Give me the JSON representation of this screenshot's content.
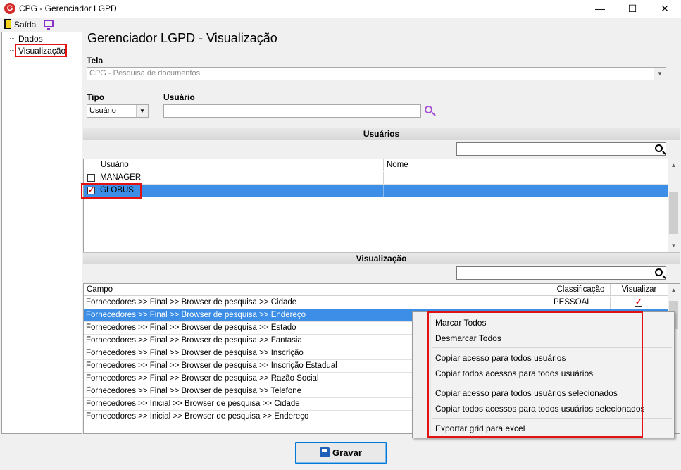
{
  "window": {
    "title": "CPG - Gerenciador LGPD",
    "minimize": "—",
    "maximize": "☐",
    "close": "✕"
  },
  "toolbar": {
    "exit_label": "Saída"
  },
  "tree": {
    "items": [
      "Dados",
      "Visualização"
    ]
  },
  "page_title": "Gerenciador LGPD - Visualização",
  "tela": {
    "label": "Tela",
    "value": "CPG - Pesquisa de documentos"
  },
  "tipo": {
    "label": "Tipo",
    "value": "Usuário"
  },
  "usuario": {
    "label": "Usuário",
    "value": ""
  },
  "users_section": {
    "title": "Usuários",
    "columns": [
      "Usuário",
      "Nome"
    ],
    "rows": [
      {
        "usuario": "MANAGER",
        "nome": "",
        "checked": false
      },
      {
        "usuario": "GLOBUS",
        "nome": "",
        "checked": true
      }
    ]
  },
  "view_section": {
    "title": "Visualização",
    "columns": [
      "Campo",
      "Classificação",
      "Visualizar"
    ],
    "rows": [
      {
        "campo": "Fornecedores >> Final >> Browser de pesquisa >> Cidade",
        "classificacao": "PESSOAL",
        "visualizar": true
      },
      {
        "campo": "Fornecedores >> Final >> Browser de pesquisa >> Endereço",
        "classificacao": "",
        "visualizar": false
      },
      {
        "campo": "Fornecedores >> Final >> Browser de pesquisa >> Estado",
        "classificacao": "",
        "visualizar": false
      },
      {
        "campo": "Fornecedores >> Final >> Browser de pesquisa >> Fantasia",
        "classificacao": "",
        "visualizar": false
      },
      {
        "campo": "Fornecedores >> Final >> Browser de pesquisa >> Inscrição",
        "classificacao": "",
        "visualizar": false
      },
      {
        "campo": "Fornecedores >> Final >> Browser de pesquisa >> Inscrição Estadual",
        "classificacao": "",
        "visualizar": false
      },
      {
        "campo": "Fornecedores >> Final >> Browser de pesquisa >> Razão Social",
        "classificacao": "",
        "visualizar": false
      },
      {
        "campo": "Fornecedores >> Final >> Browser de pesquisa >> Telefone",
        "classificacao": "",
        "visualizar": false
      },
      {
        "campo": "Fornecedores >> Inicial >> Browser de pesquisa >> Cidade",
        "classificacao": "",
        "visualizar": false
      },
      {
        "campo": "Fornecedores >> Inicial >> Browser de pesquisa >> Endereço",
        "classificacao": "",
        "visualizar": false
      }
    ]
  },
  "context_menu": {
    "items": [
      "Marcar Todos",
      "Desmarcar Todos",
      "Copiar acesso para todos usuários",
      "Copiar todos acessos para todos usuários",
      "Copiar acesso para todos usuários selecionados",
      "Copiar todos acessos para todos usuários selecionados",
      "Exportar grid para excel"
    ]
  },
  "save_button": {
    "label": "Gravar"
  },
  "colors": {
    "highlight": "#e31212",
    "selection": "#3d8ee6"
  }
}
